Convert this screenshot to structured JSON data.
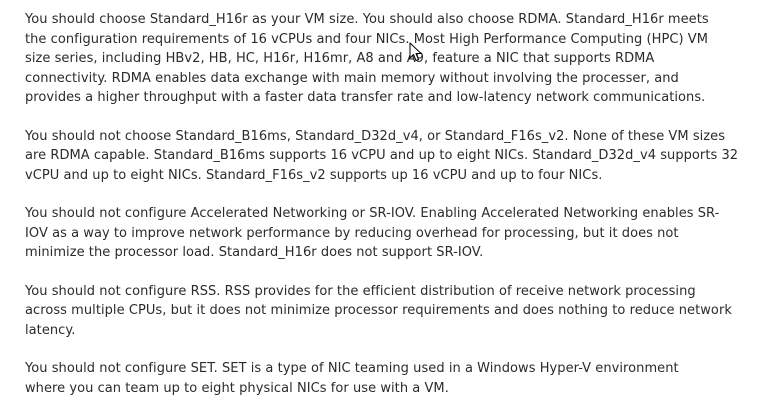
{
  "explanation": {
    "paragraphs": [
      {
        "lines": [
          "You should choose Standard_H16r as your VM size. You should also choose RDMA. Standard_H16r meets",
          "the configuration requirements of 16 vCPUs and four NICs. Most High Performance Computing (HPC) VM",
          "size series, including HBv2, HB, HC, H16r, H16mr, A8 and A9, feature a NIC that supports RDMA",
          "connectivity. RDMA enables data exchange with main memory without involving the processer, and",
          "provides a higher throughput with a faster data transfer rate and low-latency network communications."
        ]
      },
      {
        "lines": [
          "You should not choose Standard_B16ms, Standard_D32d_v4, or Standard_F16s_v2. None of these VM sizes",
          "are RDMA capable. Standard_B16ms supports 16 vCPU and up to eight NICs. Standard_D32d_v4 supports 32",
          "vCPU and up to eight NICs. Standard_F16s_v2 supports up 16 vCPU and up to four NICs."
        ]
      },
      {
        "lines": [
          "You should not configure Accelerated Networking or SR-IOV. Enabling Accelerated Networking enables SR-",
          "IOV as a way to improve network performance by reducing overhead for processing, but it does not",
          "minimize the processor load. Standard_H16r does not support SR-IOV."
        ]
      },
      {
        "lines": [
          "You should not configure RSS. RSS provides for the efficient distribution of receive network processing",
          "across multiple CPUs, but it does not minimize processor requirements and does nothing to reduce network",
          "latency."
        ]
      },
      {
        "lines": [
          "You should not configure SET. SET is a type of NIC teaming used in a Windows Hyper-V environment",
          "where you can team up to eight physical NICs for use with a VM."
        ]
      }
    ]
  },
  "cursor": {
    "icon": "mouse-pointer-icon"
  }
}
